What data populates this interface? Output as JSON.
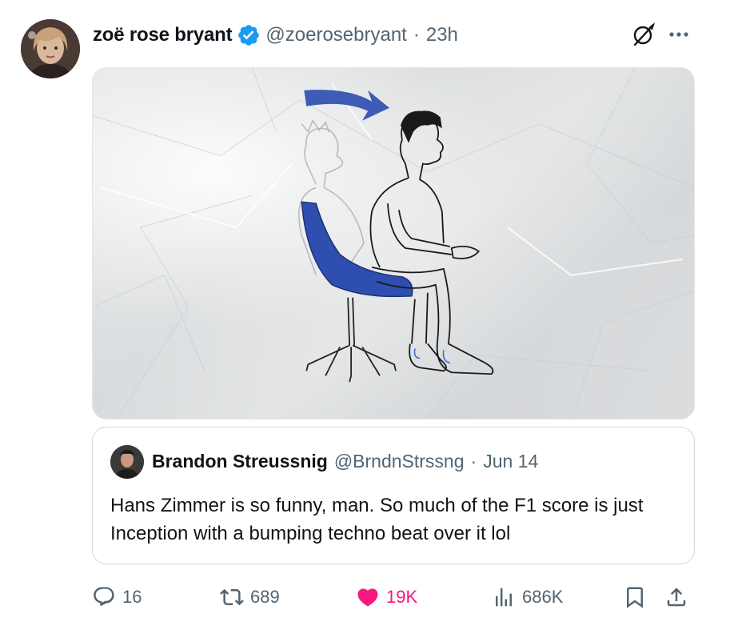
{
  "author": {
    "display_name": "zoë rose bryant",
    "handle": "@zoerosebryant",
    "separator": "·",
    "time": "23h",
    "verified": true,
    "avatar_icon": "user-avatar"
  },
  "header_icons": [
    "grok-icon",
    "more-icon"
  ],
  "media": {
    "type": "image",
    "icon": "illustration-man-sliding-into-chair"
  },
  "quoted": {
    "display_name": "Brandon Streussnig",
    "handle": "@BrndnStrssng",
    "separator": "·",
    "date": "Jun 14",
    "text": "Hans Zimmer is so funny, man. So much of the F1 score is just Inception with a bumping techno beat over it lol"
  },
  "actions": {
    "replies": "16",
    "reposts": "689",
    "likes": "19K",
    "views": "686K"
  },
  "colors": {
    "text_primary": "#0f1419",
    "text_secondary": "#536471",
    "verified_blue": "#1d9bf0",
    "like_pink": "#f91880",
    "border": "#cfd9de",
    "chair_blue": "#2f4fb0"
  }
}
